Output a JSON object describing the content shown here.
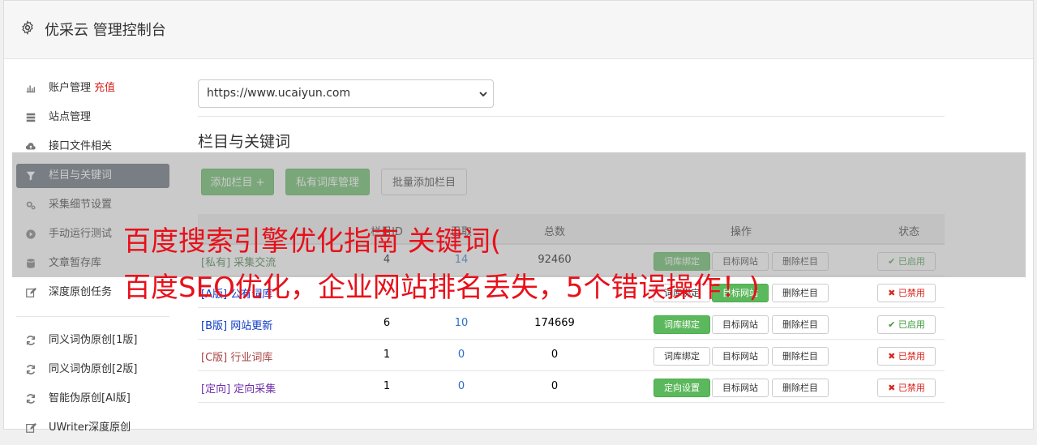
{
  "header": {
    "title": "优采云 管理控制台"
  },
  "sidebar": {
    "items": [
      {
        "label": "账户管理",
        "extra": "充值",
        "icon": "bar-chart-icon"
      },
      {
        "label": "站点管理",
        "icon": "server-icon"
      },
      {
        "label": "接口文件相关",
        "icon": "cloud-upload-icon"
      },
      {
        "label": "栏目与关键词",
        "icon": "filter-icon",
        "active": true
      },
      {
        "label": "采集细节设置",
        "icon": "gears-icon"
      },
      {
        "label": "手动运行测试",
        "icon": "play-circle-icon"
      },
      {
        "label": "文章暂存库",
        "icon": "database-icon"
      },
      {
        "label": "深度原创任务",
        "icon": "edit-icon"
      },
      {
        "label": "同义词伪原创[1版]",
        "icon": "refresh-icon"
      },
      {
        "label": "同义词伪原创[2版]",
        "icon": "refresh-icon"
      },
      {
        "label": "智能伪原创[AI版]",
        "icon": "refresh-icon"
      },
      {
        "label": "UWriter深度原创",
        "icon": "edit-icon"
      }
    ]
  },
  "main": {
    "site_select": {
      "value": "https://www.ucaiyun.com"
    },
    "section_title": "栏目与关键词",
    "buttons": {
      "add_column": "添加栏目 +",
      "private_lib": "私有词库管理",
      "batch_add": "批量添加栏目"
    },
    "table": {
      "headers": {
        "col2": "栏目ID",
        "col3": "已取",
        "col4": "总数",
        "ops": "操作",
        "status": "状态"
      },
      "rows": [
        {
          "tag": "[私有]",
          "name": "采集交流",
          "a": "4",
          "b": "14",
          "c": "92460",
          "op1": "词库绑定",
          "op1_primary": true,
          "op2": "目标网站",
          "op2_primary": false,
          "op3": "删除栏目",
          "status": "已启用",
          "on": true,
          "color": "green"
        },
        {
          "tag": "[A版]",
          "name": "公有词库",
          "a": "",
          "b": "",
          "c": "",
          "op1": "词库绑定",
          "op1_primary": false,
          "op2": "目标网站",
          "op2_primary": true,
          "op3": "删除栏目",
          "status": "已禁用",
          "on": false,
          "color": "blue"
        },
        {
          "tag": "[B版]",
          "name": "网站更新",
          "a": "6",
          "b": "10",
          "c": "174669",
          "op1": "词库绑定",
          "op1_primary": true,
          "op2": "目标网站",
          "op2_primary": false,
          "op3": "删除栏目",
          "status": "已启用",
          "on": true,
          "color": "blue"
        },
        {
          "tag": "[C版]",
          "name": "行业词库",
          "a": "1",
          "b": "0",
          "c": "0",
          "op1": "词库绑定",
          "op1_primary": false,
          "op2": "目标网站",
          "op2_primary": false,
          "op3": "删除栏目",
          "status": "已禁用",
          "on": false,
          "color": "red"
        },
        {
          "tag": "[定向]",
          "name": "定向采集",
          "a": "1",
          "b": "0",
          "c": "0",
          "op1": "定向设置",
          "op1_primary": true,
          "op2": "目标网站",
          "op2_primary": false,
          "op3": "删除栏目",
          "status": "已禁用",
          "on": false,
          "color": "purple"
        }
      ]
    }
  },
  "overlay": {
    "line1": "百度搜索引擎优化指南 关键词(",
    "line2": "百度SEO优化，企业网站排名丢失，5个错误操作！)"
  }
}
